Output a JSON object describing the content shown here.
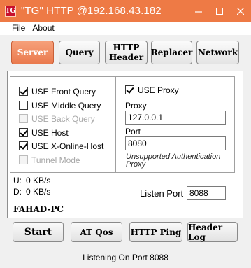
{
  "window": {
    "title": "\"TG\" HTTP @192.168.43.182",
    "icon_text": "TG"
  },
  "menu": [
    "File",
    "About"
  ],
  "tabs": [
    {
      "label": "Server",
      "active": true
    },
    {
      "label": "Query",
      "active": false
    },
    {
      "label": "HTTP Header",
      "line1": "HTTP",
      "line2": "Header",
      "active": false
    },
    {
      "label": "Replacer",
      "active": false
    },
    {
      "label": "Network",
      "active": false
    }
  ],
  "query_options": [
    {
      "label": "USE Front Query",
      "checked": true,
      "enabled": true
    },
    {
      "label": "USE Middle Query",
      "checked": false,
      "enabled": true
    },
    {
      "label": "USE Back Query",
      "checked": false,
      "enabled": false
    },
    {
      "label": "USE Host",
      "checked": true,
      "enabled": true
    },
    {
      "label": "USE X-Online-Host",
      "checked": true,
      "enabled": true
    },
    {
      "label": "Tunnel Mode",
      "checked": false,
      "enabled": false
    }
  ],
  "proxy": {
    "use_proxy_label": "USE Proxy",
    "use_proxy_checked": true,
    "proxy_label": "Proxy",
    "proxy_value": "127.0.0.1",
    "port_label": "Port",
    "port_value": "8080",
    "note": "Unsupported Authentication Proxy"
  },
  "stats": {
    "upload_label": "U:",
    "upload_value": "0 KB/s",
    "download_label": "D:",
    "download_value": "0 KB/s"
  },
  "listen": {
    "label": "Listen Port",
    "value": "8088"
  },
  "computer_name": "FAHAD-PC",
  "buttons": {
    "start": "Start",
    "at_qos": "AT Qos",
    "http_ping": "HTTP Ping",
    "header_log": "Header Log"
  },
  "status": "Listening On Port 8088",
  "colors": {
    "accent": "#ee7a45",
    "tab_active": "#ea7a4e"
  }
}
